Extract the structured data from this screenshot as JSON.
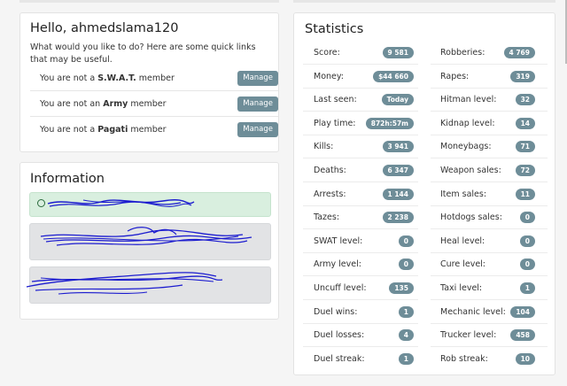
{
  "welcome": {
    "title": "Hello, ahmedslama120",
    "intro": "What would you like to do? Here are some quick links that may be useful.",
    "memberships": [
      {
        "prefix": "You are not a ",
        "group": "S.W.A.T.",
        "suffix": " member",
        "button": "Manage"
      },
      {
        "prefix": "You are not an ",
        "group": "Army",
        "suffix": " member",
        "button": "Manage"
      },
      {
        "prefix": "You are not a ",
        "group": "Pagati",
        "suffix": " member",
        "button": "Manage"
      }
    ]
  },
  "information": {
    "title": "Information",
    "alerts": [
      "success",
      "neutral",
      "neutral"
    ],
    "colors": {
      "success_bg": "#d9efdf",
      "success_border": "#c5e3cd",
      "neutral_bg": "#e2e3e5",
      "neutral_border": "#d6d8db",
      "scribble": "#1c1ccf"
    }
  },
  "statistics": {
    "title": "Statistics",
    "left": [
      {
        "label": "Score:",
        "value": "9 581"
      },
      {
        "label": "Money:",
        "value": "$44 660"
      },
      {
        "label": "Last seen:",
        "value": "Today"
      },
      {
        "label": "Play time:",
        "value": "872h:57m"
      },
      {
        "label": "Kills:",
        "value": "3 941"
      },
      {
        "label": "Deaths:",
        "value": "6 347"
      },
      {
        "label": "Arrests:",
        "value": "1 144"
      },
      {
        "label": "Tazes:",
        "value": "2 238"
      },
      {
        "label": "SWAT level:",
        "value": "0"
      },
      {
        "label": "Army level:",
        "value": "0"
      },
      {
        "label": "Uncuff level:",
        "value": "135"
      },
      {
        "label": "Duel wins:",
        "value": "1"
      },
      {
        "label": "Duel losses:",
        "value": "4"
      },
      {
        "label": "Duel streak:",
        "value": "1"
      }
    ],
    "right": [
      {
        "label": "Robberies:",
        "value": "4 769"
      },
      {
        "label": "Rapes:",
        "value": "319"
      },
      {
        "label": "Hitman level:",
        "value": "32"
      },
      {
        "label": "Kidnap level:",
        "value": "14"
      },
      {
        "label": "Moneybags:",
        "value": "71"
      },
      {
        "label": "Weapon sales:",
        "value": "72"
      },
      {
        "label": "Item sales:",
        "value": "11"
      },
      {
        "label": "Hotdogs sales:",
        "value": "0"
      },
      {
        "label": "Heal level:",
        "value": "0"
      },
      {
        "label": "Cure level:",
        "value": "0"
      },
      {
        "label": "Taxi level:",
        "value": "1"
      },
      {
        "label": "Mechanic level:",
        "value": "104"
      },
      {
        "label": "Trucker level:",
        "value": "458"
      },
      {
        "label": "Rob streak:",
        "value": "10"
      }
    ]
  },
  "theme": {
    "badge": "#6e8d98",
    "page_bg": "#f5f5f5"
  }
}
